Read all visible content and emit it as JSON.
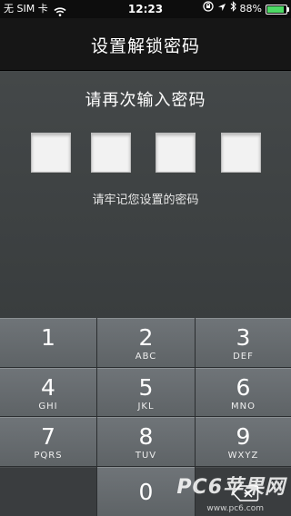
{
  "status_bar": {
    "carrier": "无 SIM 卡",
    "time": "12:23",
    "battery_percent": "88%",
    "battery_level": 0.88
  },
  "title_bar": {
    "title": "设置解锁密码"
  },
  "main": {
    "prompt": "请再次输入密码",
    "hint": "请牢记您设置的密码",
    "passcode_boxes": 4
  },
  "keypad": {
    "keys": [
      {
        "digit": "1",
        "letters": ""
      },
      {
        "digit": "2",
        "letters": "ABC"
      },
      {
        "digit": "3",
        "letters": "DEF"
      },
      {
        "digit": "4",
        "letters": "GHI"
      },
      {
        "digit": "5",
        "letters": "JKL"
      },
      {
        "digit": "6",
        "letters": "MNO"
      },
      {
        "digit": "7",
        "letters": "PQRS"
      },
      {
        "digit": "8",
        "letters": "TUV"
      },
      {
        "digit": "9",
        "letters": "WXYZ"
      },
      {
        "digit": "0",
        "letters": ""
      }
    ]
  },
  "watermark": {
    "text": "PC6苹果网",
    "url": "www.pc6.com"
  }
}
